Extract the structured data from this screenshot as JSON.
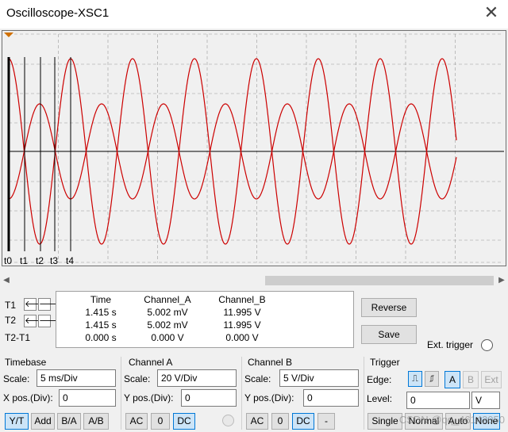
{
  "window": {
    "title": "Oscilloscope-XSC1"
  },
  "screen": {
    "cursor_labels": [
      "t0",
      "t1",
      "t2",
      "t3",
      "t4"
    ],
    "colors": {
      "background": "#f0f0f0",
      "trace": "#cc0000",
      "grid": "#9a9a9a",
      "cursor": "#000000"
    }
  },
  "readout": {
    "headers": {
      "time": "Time",
      "a": "Channel_A",
      "b": "Channel_B"
    },
    "rows": [
      {
        "label": "T1",
        "time": "1.415 s",
        "a": "5.002 mV",
        "b": "11.995 V"
      },
      {
        "label": "T2",
        "time": "1.415 s",
        "a": "5.002 mV",
        "b": "11.995 V"
      },
      {
        "label": "T2-T1",
        "time": "0.000 s",
        "a": "0.000 V",
        "b": "0.000 V"
      }
    ]
  },
  "buttons": {
    "reverse": "Reverse",
    "save": "Save",
    "ext_trigger": "Ext. trigger"
  },
  "timebase": {
    "title": "Timebase",
    "scale_label": "Scale:",
    "scale_value": "5 ms/Div",
    "xpos_label": "X pos.(Div):",
    "xpos_value": "0",
    "modes": [
      "Y/T",
      "Add",
      "B/A",
      "A/B"
    ]
  },
  "channel_a": {
    "title": "Channel A",
    "scale_label": "Scale:",
    "scale_value": "20  V/Div",
    "ypos_label": "Y pos.(Div):",
    "ypos_value": "0",
    "coupling": [
      "AC",
      "0",
      "DC"
    ]
  },
  "channel_b": {
    "title": "Channel B",
    "scale_label": "Scale:",
    "scale_value": "5  V/Div",
    "ypos_label": "Y pos.(Div):",
    "ypos_value": "0",
    "coupling": [
      "AC",
      "0",
      "DC",
      "-"
    ]
  },
  "trigger": {
    "title": "Trigger",
    "edge_label": "Edge:",
    "level_label": "Level:",
    "level_value": "0",
    "level_unit": "V",
    "edge_rise_icon": "rising-edge-icon",
    "edge_fall_icon": "falling-edge-icon",
    "sources": [
      "A",
      "B",
      "Ext"
    ],
    "modes": [
      "Single",
      "Normal",
      "Auto",
      "None"
    ]
  },
  "watermark": "CSDN @qq_46142050"
}
